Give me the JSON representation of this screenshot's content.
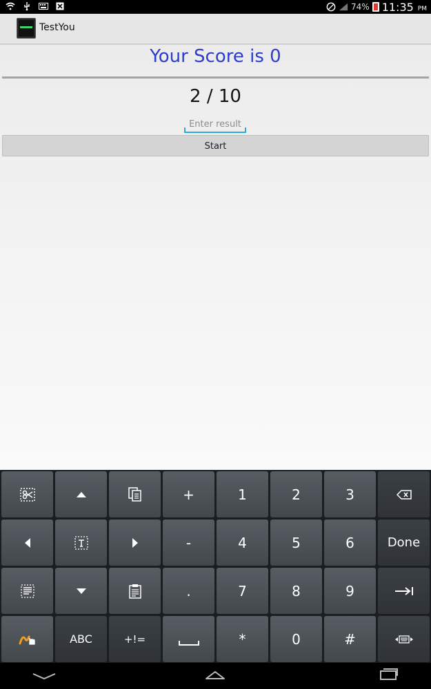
{
  "status_bar": {
    "battery": "74%",
    "time": "11:35",
    "ampm": "PM",
    "icons": [
      "wifi-icon",
      "usb-icon",
      "keyboard-icon",
      "close-notification-icon",
      "no-sim-icon",
      "signal-icon",
      "battery-icon"
    ]
  },
  "app": {
    "title": "TestYou"
  },
  "content": {
    "score_text": "Your Score is 0",
    "progress_text": "2 / 10",
    "result_placeholder": "Enter result",
    "start_label": "Start"
  },
  "keyboard": {
    "keys": {
      "one": "1",
      "two": "2",
      "three": "3",
      "four": "4",
      "five": "5",
      "six": "6",
      "seven": "7",
      "eight": "8",
      "nine": "9",
      "zero": "0",
      "plus": "+",
      "minus": "-",
      "dot": ".",
      "star": "*",
      "hash": "#",
      "abc": "ABC",
      "symbols": "+!=",
      "done": "Done"
    }
  },
  "colors": {
    "score": "#2b3ccf",
    "accent_underline": "#2aa8d9",
    "keyboard_bg": "#1b1e21"
  }
}
